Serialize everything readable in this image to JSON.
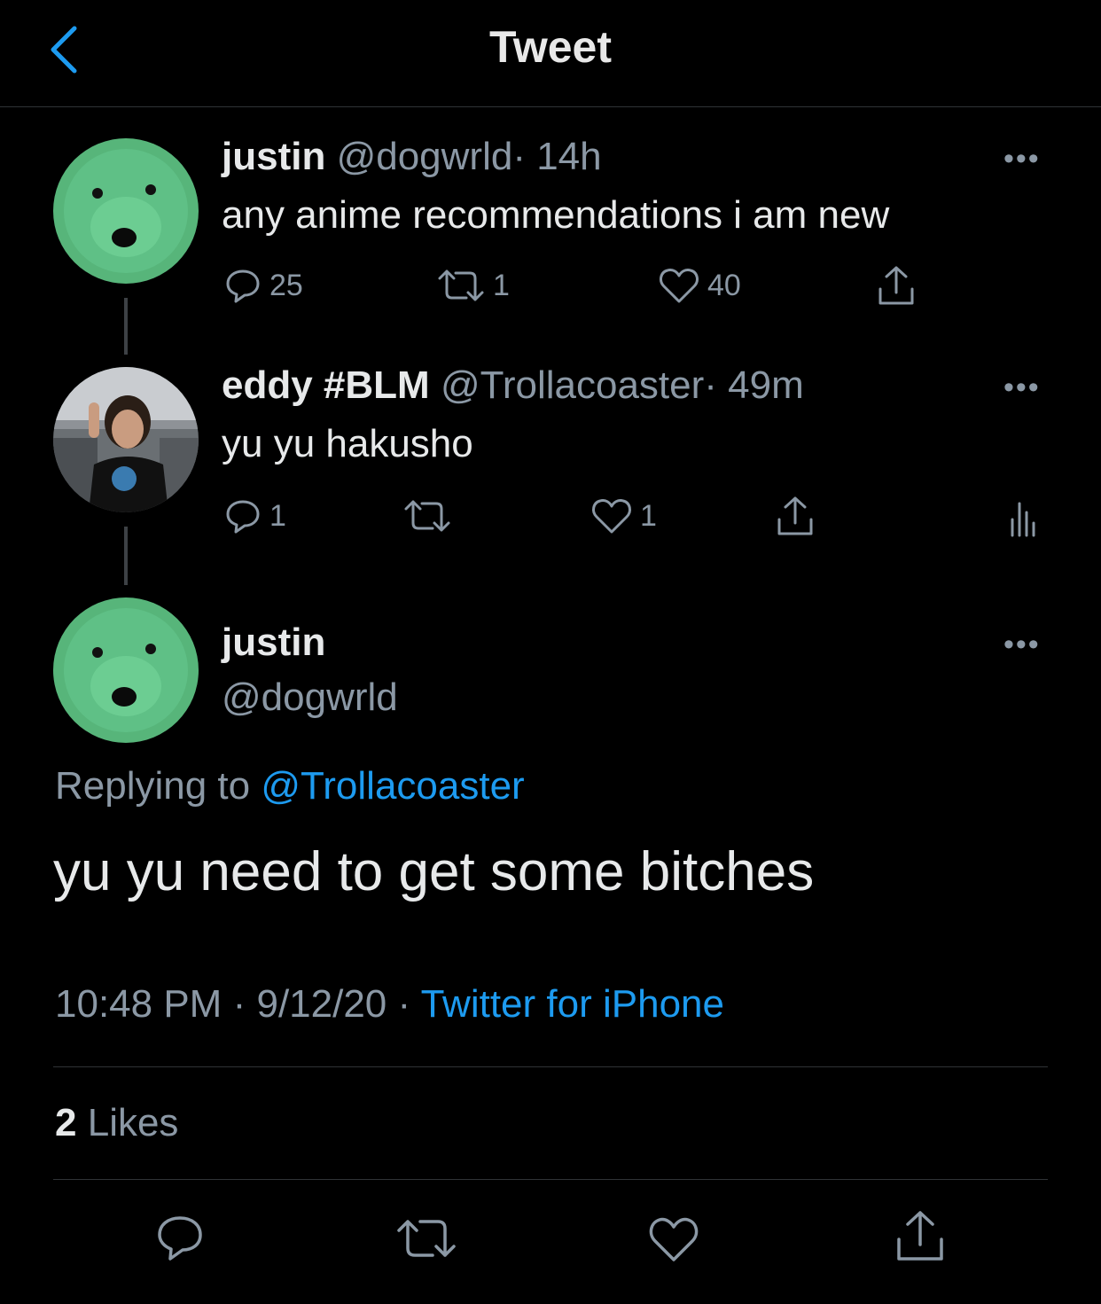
{
  "header": {
    "title": "Tweet"
  },
  "thread": [
    {
      "name": "justin",
      "handle": "@dogwrld",
      "time": "· 14h",
      "text": "any anime recommendations i am new",
      "replies": "25",
      "retweets": "1",
      "likes": "40"
    },
    {
      "name": "eddy #BLM",
      "handle": "@Trollacoaster",
      "time": "· 49m",
      "text": "yu yu hakusho",
      "replies": "1",
      "retweets": "",
      "likes": "1"
    }
  ],
  "main": {
    "name": "justin",
    "handle": "@dogwrld",
    "replying_prefix": "Replying to ",
    "replying_to": "@Trollacoaster",
    "text": "yu yu need to get some bitches",
    "time": "10:48 PM",
    "date": "9/12/20",
    "sep": "·",
    "source": "Twitter for iPhone",
    "likes_count": "2",
    "likes_label": "Likes"
  },
  "colors": {
    "accent": "#1d9bf0",
    "avatar_green": "#5fb97f"
  },
  "icons": [
    "chevron-left-icon",
    "more-icon",
    "reply-icon",
    "retweet-icon",
    "like-icon",
    "share-icon",
    "analytics-icon"
  ]
}
